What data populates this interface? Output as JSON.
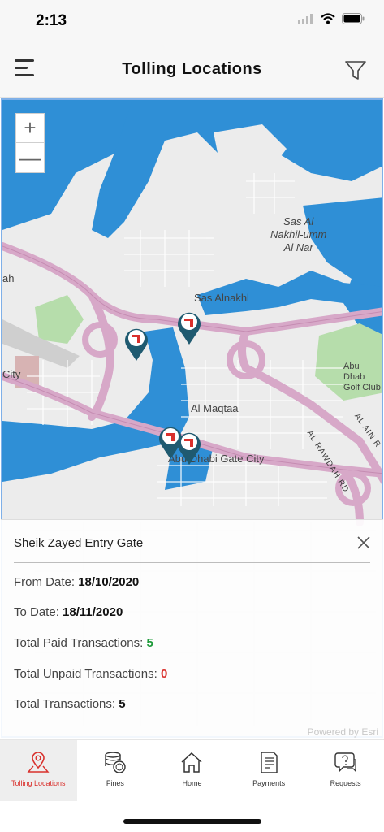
{
  "status_bar": {
    "time": "2:13"
  },
  "header": {
    "title": "Tolling Locations"
  },
  "map": {
    "labels": {
      "sas_nakhil_umm": "Sas Al\nNakhil-umm\nAl Nar",
      "sas_alnakhl": "Sas Alnakhl",
      "abu_dhabi_golf": "Abu Dhab\nGolf Club",
      "al_maqtaa": "Al Maqtaa",
      "gate_city": "Abu Dhabi Gate City",
      "al_rawdah": "AL RAWDAH RD",
      "al_ain": "AL AIN R",
      "city": "City",
      "ah": "ah"
    },
    "zoom_in": "+",
    "zoom_out": "—"
  },
  "popup": {
    "title": "Sheik Zayed Entry Gate",
    "from_label": "From Date:",
    "from_value": "18/10/2020",
    "to_label": "To Date:",
    "to_value": "18/11/2020",
    "paid_label": "Total Paid Transactions:",
    "paid_value": "5",
    "unpaid_label": "Total Unpaid Transactions:",
    "unpaid_value": "0",
    "total_label": "Total Transactions:",
    "total_value": "5",
    "powered_by": "Powered by Esri"
  },
  "nav": {
    "items": [
      {
        "label": "Tolling Locations",
        "icon": "location-pin-icon"
      },
      {
        "label": "Fines",
        "icon": "coins-icon"
      },
      {
        "label": "Home",
        "icon": "home-icon"
      },
      {
        "label": "Payments",
        "icon": "document-icon"
      },
      {
        "label": "Requests",
        "icon": "question-chat-icon"
      }
    ],
    "active_index": 0
  },
  "colors": {
    "accent": "#d9302c",
    "pin": "#1f5a70",
    "water": "#2f8fd6",
    "road": "#d7a8c8",
    "park": "#b6ddab",
    "paid_value": "#1e9a3a"
  }
}
